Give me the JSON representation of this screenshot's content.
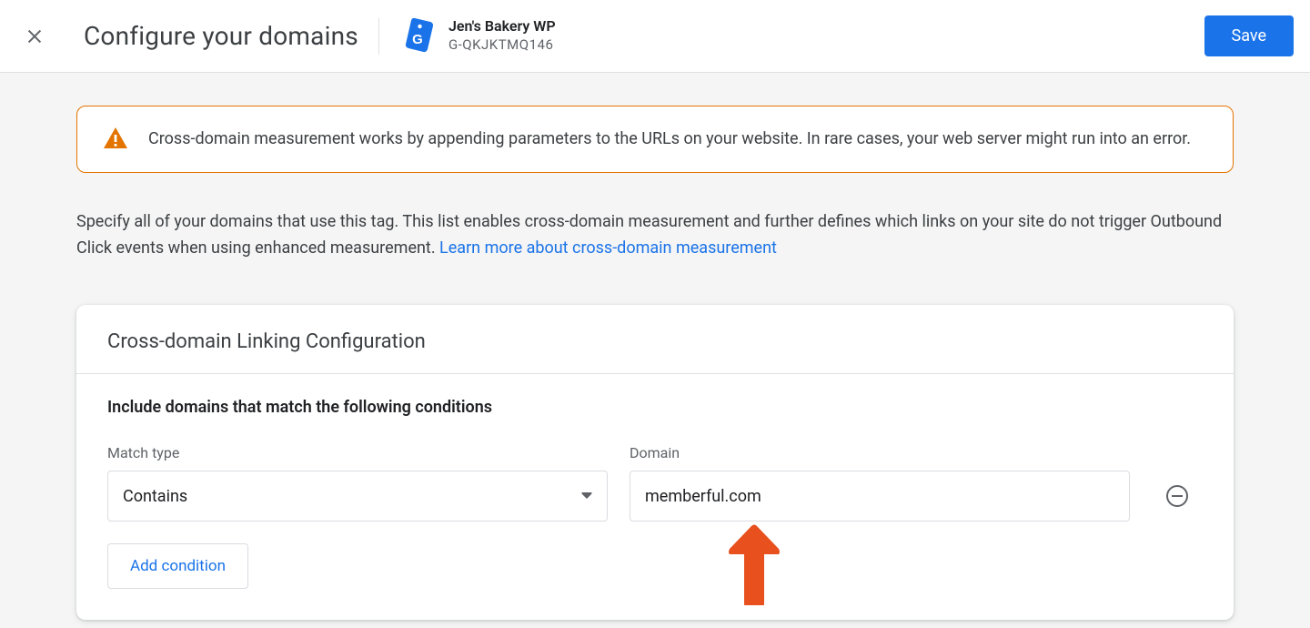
{
  "header": {
    "title": "Configure your domains",
    "property_name": "Jen's Bakery WP",
    "property_id": "G-QKJKTMQ146",
    "save_label": "Save"
  },
  "warning": {
    "text": "Cross-domain measurement works by appending parameters to the URLs on your website. In rare cases, your web server might run into an error."
  },
  "instruction": {
    "text": "Specify all of your domains that use this tag. This list enables cross-domain measurement and further defines which links on your site do not trigger Outbound Click events when using enhanced measurement. ",
    "link_text": "Learn more about cross-domain measurement"
  },
  "card": {
    "title": "Cross-domain Linking Configuration",
    "subheader": "Include domains that match the following conditions",
    "match_type_label": "Match type",
    "domain_label": "Domain",
    "condition": {
      "match_type": "Contains",
      "domain_value": "memberful.com"
    },
    "add_condition_label": "Add condition"
  }
}
